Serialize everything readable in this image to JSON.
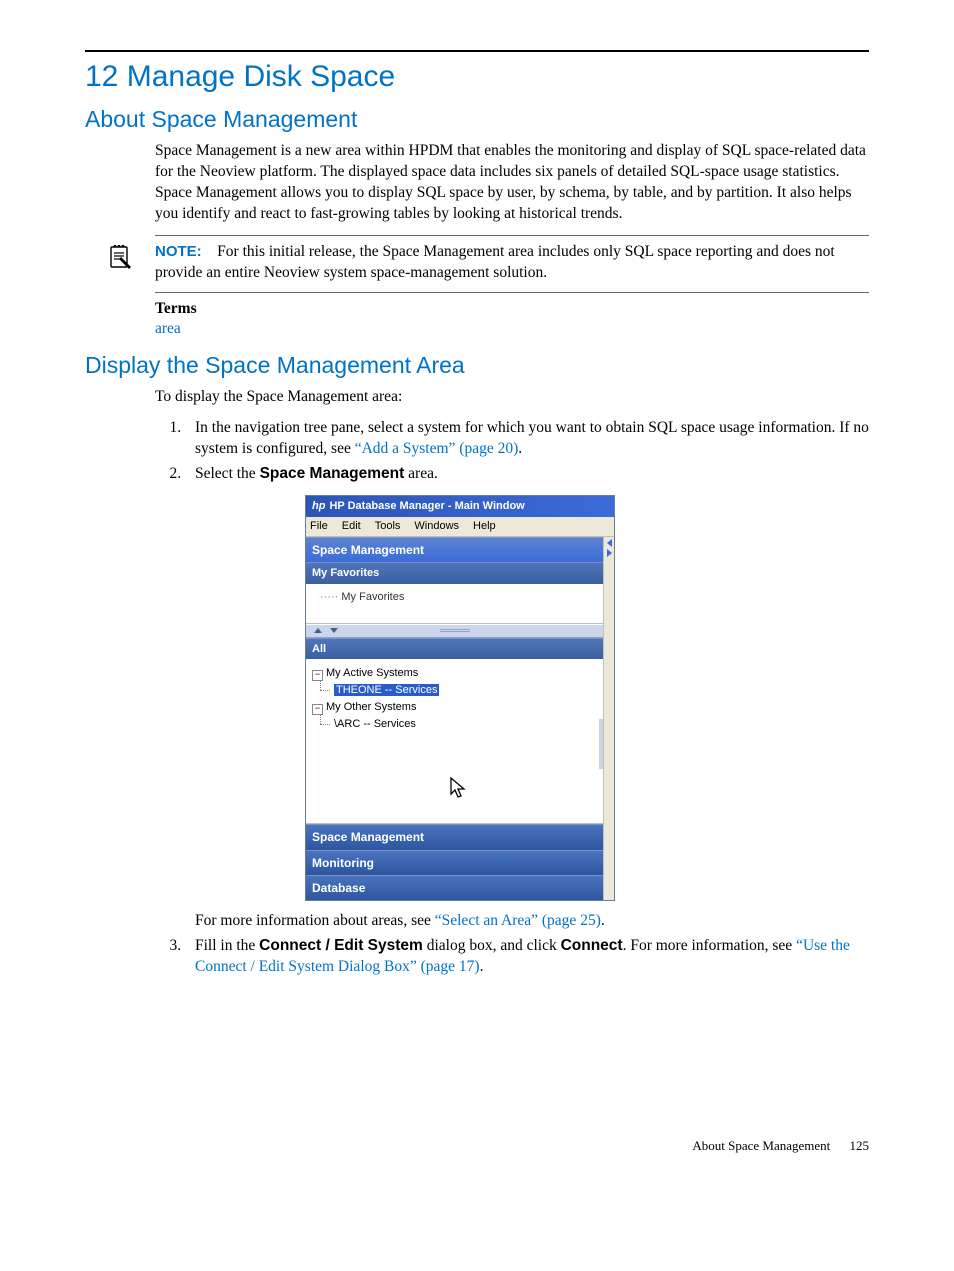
{
  "chapter": {
    "title": "12 Manage Disk Space"
  },
  "section_about": {
    "title": "About Space Management",
    "para": "Space Management is a new area within HPDM that enables the monitoring and display of SQL space-related data for the Neoview platform. The displayed space data includes six panels of detailed SQL-space usage statistics. Space Management allows you to display SQL space by user, by schema, by table, and by partition. It also helps you identify and react to fast-growing tables by looking at historical trends."
  },
  "note": {
    "label": "NOTE:",
    "text": "For this initial release, the Space Management area includes only SQL space reporting and does not provide an entire Neoview system space-management solution."
  },
  "terms": {
    "label": "Terms",
    "link": "area"
  },
  "section_display": {
    "title": "Display the Space Management Area",
    "intro": "To display the Space Management area:",
    "step1_pre": "In the navigation tree pane, select a system for which you want to obtain SQL space usage information. If no system is configured, see ",
    "step1_link": "“Add a System” (page 20)",
    "step1_post": ".",
    "step2_pre": "Select the ",
    "step2_bold": "Space Management",
    "step2_post": " area.",
    "after_image_pre": "For more information about areas, see ",
    "after_image_link": "“Select an Area” (page 25)",
    "after_image_post": ".",
    "step3_pre": "Fill in the ",
    "step3_bold1": "Connect / Edit System",
    "step3_mid": " dialog box, and click ",
    "step3_bold2": "Connect",
    "step3_post1": ". For more information, see ",
    "step3_link": "“Use the Connect / Edit System Dialog Box” (page 17)",
    "step3_post2": "."
  },
  "screenshot": {
    "title_prefix": "hp",
    "title": "HP Database Manager - Main Window",
    "menu": {
      "file": "File",
      "edit": "Edit",
      "tools": "Tools",
      "windows": "Windows",
      "help": "Help"
    },
    "bar_space": "Space Management",
    "bar_myfav": "My Favorites",
    "fav_item": "My Favorites",
    "bar_all": "All",
    "tree": {
      "active": "My Active Systems",
      "active_child": "THEONE -- Services",
      "other": "My Other Systems",
      "other_child": "\\ARC -- Services"
    },
    "bar_space2": "Space Management",
    "bar_monitoring": "Monitoring",
    "bar_database": "Database"
  },
  "footer": {
    "text": "About Space Management",
    "page": "125"
  }
}
